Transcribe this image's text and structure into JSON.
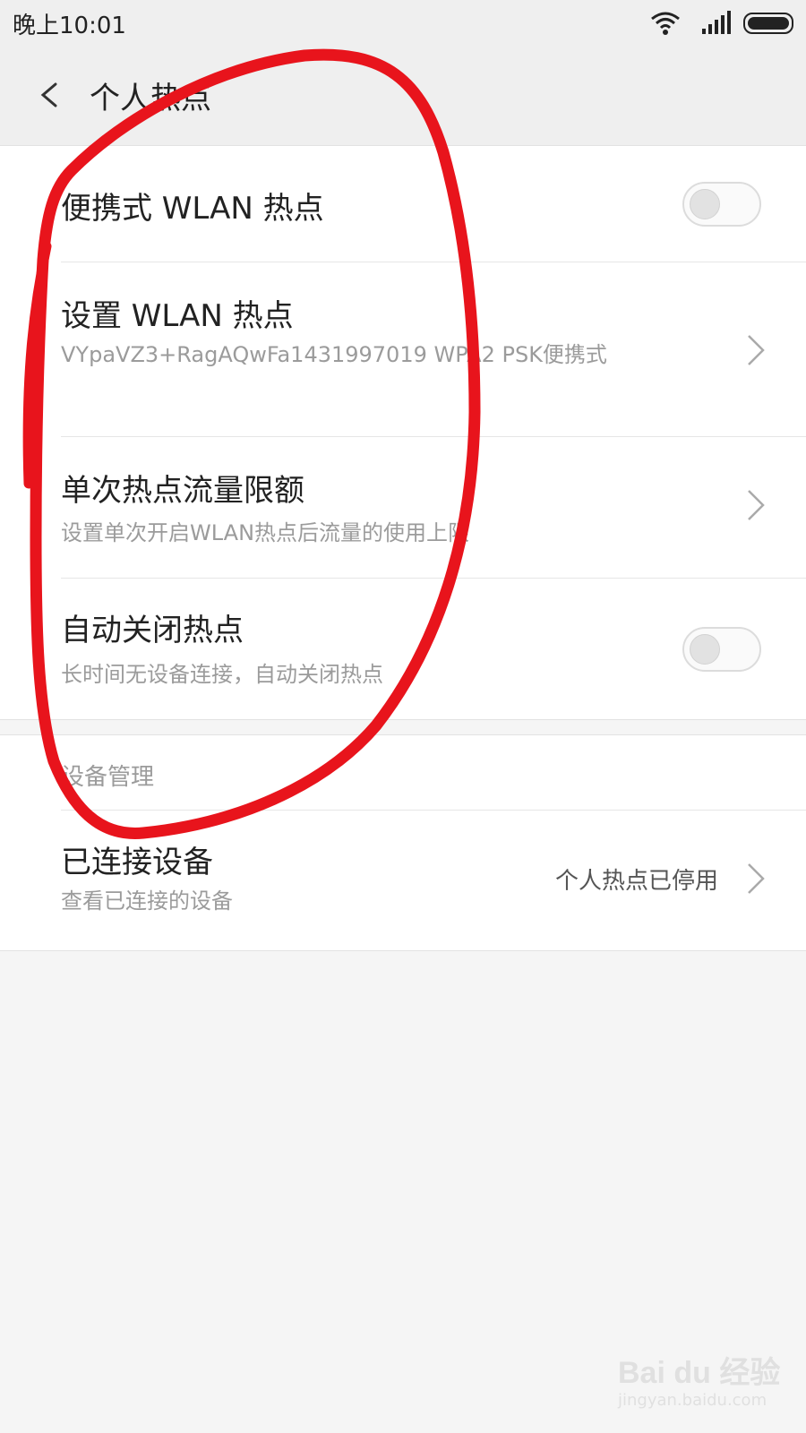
{
  "status_bar": {
    "time": "晚上10:01",
    "icons": [
      "wifi-icon",
      "signal-icon",
      "battery-icon"
    ]
  },
  "header": {
    "title": "个人热点",
    "back_icon": "chevron-left-icon"
  },
  "settings": {
    "portable_hotspot": {
      "title": "便携式 WLAN 热点",
      "enabled": false
    },
    "setup_hotspot": {
      "title": "设置 WLAN 热点",
      "subtitle": "VYpaVZ3+RagAQwFa1431997019 WPA2 PSK便携式"
    },
    "data_limit": {
      "title": "单次热点流量限额",
      "subtitle": "设置单次开启WLAN热点后流量的使用上限"
    },
    "auto_off": {
      "title": "自动关闭热点",
      "subtitle": "长时间无设备连接，自动关闭热点",
      "enabled": false
    }
  },
  "device_management": {
    "section_title": "设备管理",
    "connected_devices": {
      "title": "已连接设备",
      "subtitle": "查看已连接的设备",
      "value": "个人热点已停用"
    }
  },
  "watermark": {
    "logo": "Bai du 经验",
    "url": "jingyan.baidu.com"
  },
  "colors": {
    "annotation_circle": "#e8141c",
    "toggle_off": "#e2e2e2",
    "subtitle_text": "#9b9b9b"
  }
}
